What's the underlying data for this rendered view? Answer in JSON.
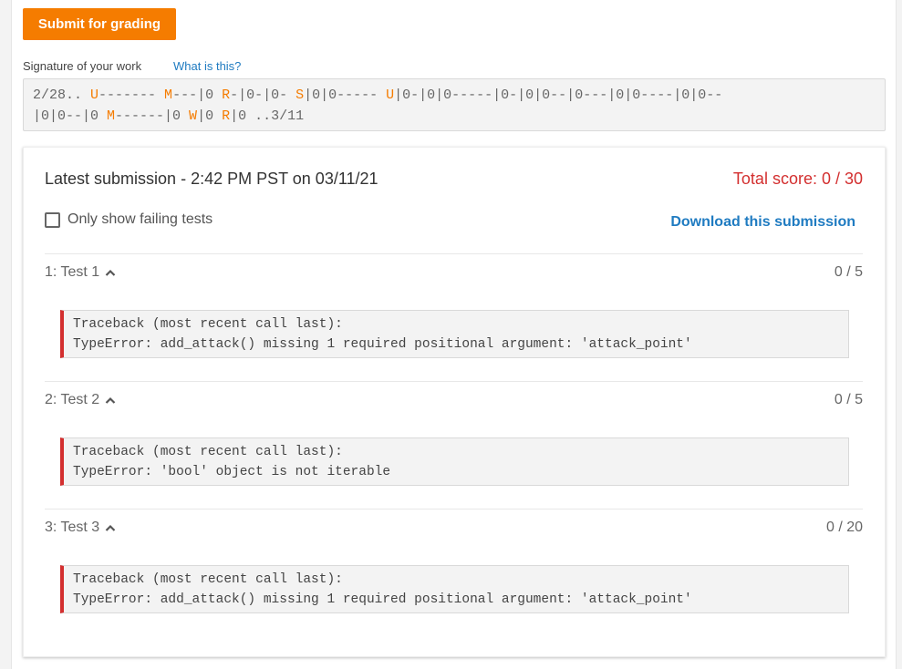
{
  "submit_button": "Submit for grading",
  "signature": {
    "label": "Signature of your work",
    "help_link": "What is this?",
    "line1": [
      {
        "t": "2/28.. ",
        "hl": false
      },
      {
        "t": "U",
        "hl": true
      },
      {
        "t": "------- ",
        "hl": false
      },
      {
        "t": "M",
        "hl": true
      },
      {
        "t": "---|0 ",
        "hl": false
      },
      {
        "t": "R",
        "hl": true
      },
      {
        "t": "-|0-|0- ",
        "hl": false
      },
      {
        "t": "S",
        "hl": true
      },
      {
        "t": "|0|0----- ",
        "hl": false
      },
      {
        "t": "U",
        "hl": true
      },
      {
        "t": "|0-|0|0-----|0-|0|0--|0---|0|0----|0|0--",
        "hl": false
      }
    ],
    "line2": [
      {
        "t": "|0|0--|0 ",
        "hl": false
      },
      {
        "t": "M",
        "hl": true
      },
      {
        "t": "------|0 ",
        "hl": false
      },
      {
        "t": "W",
        "hl": true
      },
      {
        "t": "|0 ",
        "hl": false
      },
      {
        "t": "R",
        "hl": true
      },
      {
        "t": "|0 ..3/11",
        "hl": false
      }
    ]
  },
  "submission": {
    "title": "Latest submission - 2:42 PM PST on 03/11/21",
    "total_score": "Total score: 0 / 30",
    "only_failing_label": "Only show failing tests",
    "only_failing_checked": false,
    "download_label": "Download this submission"
  },
  "tests": [
    {
      "title": "1: Test 1",
      "score": "0 / 5",
      "trace": [
        "Traceback (most recent call last):",
        "TypeError: add_attack() missing 1 required positional argument: 'attack_point'"
      ]
    },
    {
      "title": "2: Test 2",
      "score": "0 / 5",
      "trace": [
        "Traceback (most recent call last):",
        "TypeError: 'bool' object is not iterable"
      ]
    },
    {
      "title": "3: Test 3",
      "score": "0 / 20",
      "trace": [
        "Traceback (most recent call last):",
        "TypeError: add_attack() missing 1 required positional argument: 'attack_point'"
      ]
    }
  ],
  "colors": {
    "accent": "#f57c00",
    "link": "#1f7bc1",
    "error": "#d32f2f"
  }
}
